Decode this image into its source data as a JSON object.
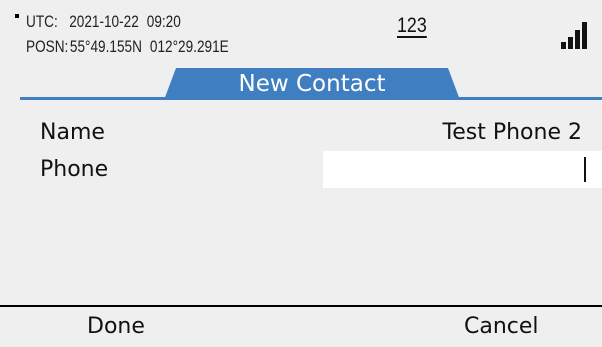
{
  "status": {
    "utc_label": "UTC:",
    "utc_date": "2021-10-22",
    "utc_time": "09:20",
    "posn_label": "POSN:",
    "posn_lat": "55°49.155N",
    "posn_lon": "012°29.291E",
    "input_mode": "123",
    "signal_icon": "signal-strength-icon",
    "signal_bars_lit": 4
  },
  "title": {
    "text": "New Contact"
  },
  "form": {
    "name_label": "Name",
    "name_value": "Test Phone 2",
    "phone_label": "Phone",
    "phone_value": ""
  },
  "softkeys": {
    "left": "Done",
    "right": "Cancel"
  },
  "colors": {
    "accent": "#3f7ec1",
    "background": "#efefef",
    "field": "#ffffff"
  }
}
